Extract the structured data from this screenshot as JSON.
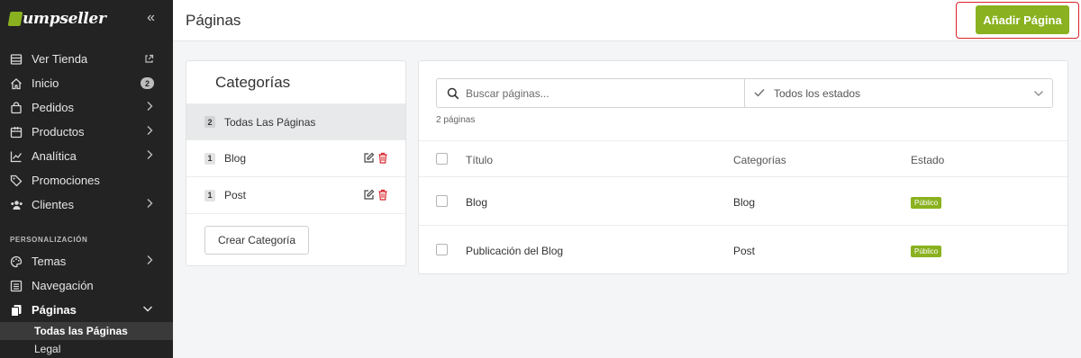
{
  "app": {
    "brand": "umpseller",
    "collapse_icon": "double-chevron-left-icon"
  },
  "sidebar": {
    "items": [
      {
        "label": "Ver Tienda",
        "icon": "store-icon",
        "trail": "external-link-icon"
      },
      {
        "label": "Inicio",
        "icon": "home-icon",
        "badge": "2"
      },
      {
        "label": "Pedidos",
        "icon": "bag-icon",
        "trail": "chevron-right-icon"
      },
      {
        "label": "Productos",
        "icon": "box-icon",
        "trail": "chevron-right-icon"
      },
      {
        "label": "Analítica",
        "icon": "chart-icon",
        "trail": "chevron-right-icon"
      },
      {
        "label": "Promociones",
        "icon": "tag-icon"
      },
      {
        "label": "Clientes",
        "icon": "users-icon",
        "trail": "chevron-right-icon"
      }
    ],
    "section_label": "PERSONALIZACIÓN",
    "items2": [
      {
        "label": "Temas",
        "icon": "palette-icon",
        "trail": "chevron-right-icon"
      },
      {
        "label": "Navegación",
        "icon": "list-icon"
      },
      {
        "label": "Páginas",
        "icon": "pages-icon",
        "trail": "chevron-down-icon"
      }
    ],
    "subitems": [
      {
        "label": "Todas las Páginas"
      },
      {
        "label": "Legal"
      }
    ]
  },
  "header": {
    "title": "Páginas",
    "add_button": "Añadir Página"
  },
  "categories": {
    "title": "Categorías",
    "items": [
      {
        "count": "2",
        "label": "Todas Las Páginas"
      },
      {
        "count": "1",
        "label": "Blog"
      },
      {
        "count": "1",
        "label": "Post"
      }
    ],
    "create_button": "Crear Categoría"
  },
  "pages": {
    "search_placeholder": "Buscar páginas...",
    "status_filter": "Todos los estados",
    "count_text": "2 páginas",
    "columns": [
      "Título",
      "Categorías",
      "Estado"
    ],
    "rows": [
      {
        "title": "Blog",
        "category": "Blog",
        "status": "Público"
      },
      {
        "title": "Publicación del Blog",
        "category": "Post",
        "status": "Público"
      }
    ]
  },
  "colors": {
    "accent": "#8ab11f",
    "sidebar_bg": "#232323",
    "highlight_border": "#d8232a",
    "danger": "#d8232a"
  }
}
